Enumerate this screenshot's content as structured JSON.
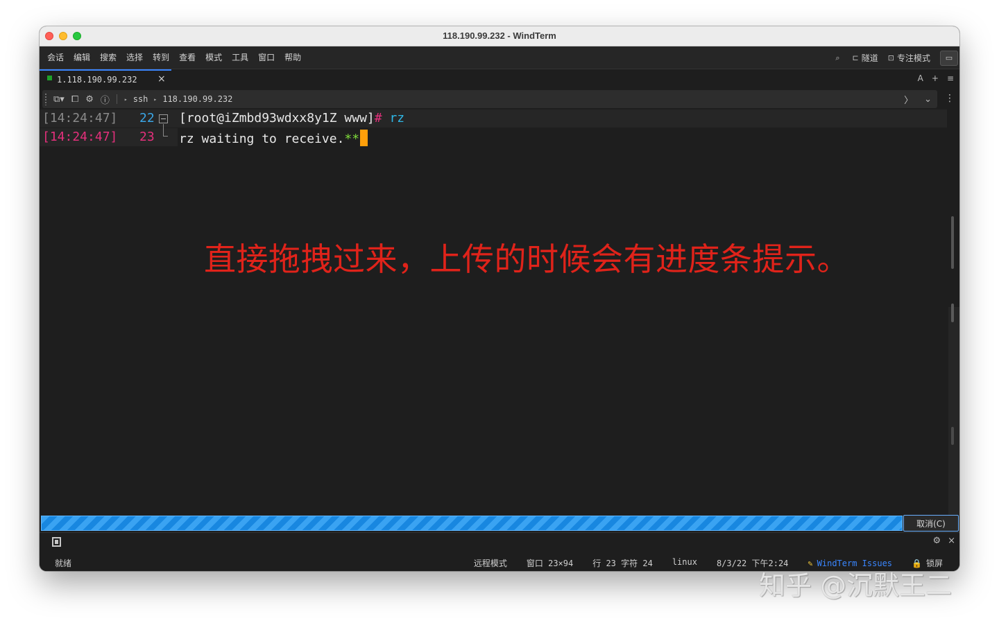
{
  "window": {
    "title": "118.190.99.232 - WindTerm"
  },
  "menu": {
    "items": [
      "会话",
      "编辑",
      "搜索",
      "选择",
      "转到",
      "查看",
      "模式",
      "工具",
      "窗口",
      "帮助"
    ]
  },
  "menu_right": {
    "tunnel_label": "隧道",
    "focus_label": "专注模式"
  },
  "tab": {
    "label": "1.118.190.99.232"
  },
  "toolbar": {
    "protocol": "ssh",
    "host": "118.190.99.232"
  },
  "terminal": {
    "lines": [
      {
        "time": "[14:24:47]",
        "line_no": "22",
        "prompt": "[root@iZmbd93wdxx8y1Z www]",
        "hash": "#",
        "command": " rz"
      },
      {
        "time": "[14:24:47]",
        "line_no": "23",
        "text": "rz waiting to receive.",
        "stars": "**"
      }
    ]
  },
  "annotation": {
    "text": "直接拖拽过来，上传的时候会有进度条提示。"
  },
  "progress": {
    "value": 1.0,
    "cancel_label": "取消(C)"
  },
  "status": {
    "state": "就绪",
    "mode": "远程模式",
    "window_size": "窗口 23×94",
    "position": "行 23 字符 24",
    "os": "linux",
    "datetime": "8/3/22 下午2:24",
    "issues": "WindTerm Issues",
    "lock": "锁屏"
  },
  "watermark": {
    "text": "知乎 @沉默王二"
  },
  "colors": {
    "accent": "#3a86ff",
    "progress": "#1a8ee8",
    "annotation": "#e0231a",
    "cursor": "#ff9f0a"
  }
}
